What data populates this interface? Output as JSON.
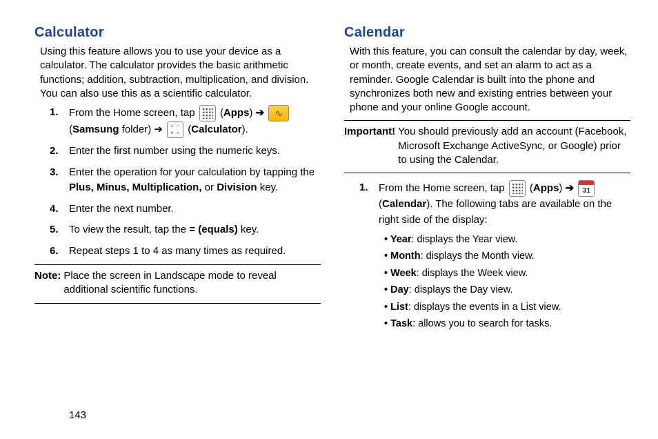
{
  "page_number": "143",
  "left": {
    "heading": "Calculator",
    "intro": "Using this feature allows you to use your device as a calculator. The calculator provides the basic arithmetic functions; addition, subtraction, multiplication, and division. You can also use this as a scientific calculator.",
    "step1_a": "From the Home screen, tap ",
    "step1_apps": "Apps",
    "step1_arrow": " ➔ ",
    "step1_samsung": "Samsung",
    "step1_folder": " folder) ➔ ",
    "step1_calc": "Calculator",
    "step2": "Enter the first number using the numeric keys.",
    "step3_a": "Enter the operation for your calculation by tapping the ",
    "step3_b": "Plus, Minus, Multiplication,",
    "step3_c": " or ",
    "step3_d": "Division",
    "step3_e": " key.",
    "step4": "Enter the next number.",
    "step5_a": "To view the result, tap the ",
    "step5_b": "=  (equals)",
    "step5_c": " key.",
    "step6": "Repeat steps 1 to 4 as many times as required.",
    "note_label": "Note:",
    "note_text": "Place the screen in Landscape mode to reveal additional scientific functions."
  },
  "right": {
    "heading": "Calendar",
    "intro": "With this feature, you can consult the calendar by day, week, or month, create events, and set an alarm to act as a reminder. Google Calendar is built into the phone and synchronizes both new and existing entries between your phone and your online Google account.",
    "imp_label": "Important!",
    "imp_text": "You should previously add an account (Facebook, Microsoft Exchange ActiveSync, or Google) prior to using the Calendar.",
    "step1_a": "From the Home screen, tap ",
    "step1_apps": "Apps",
    "step1_arrow": " ➔ ",
    "step1_cal": "Calendar",
    "step1_b": "). The following tabs are available on the right side of the display:",
    "bullets": {
      "year_b": "Year",
      "year_t": ": displays the Year view.",
      "month_b": "Month",
      "month_t": ": displays the Month view.",
      "week_b": "Week",
      "week_t": ": displays the Week view.",
      "day_b": "Day",
      "day_t": ": displays the Day view.",
      "list_b": "List",
      "list_t": ": displays the events in a List view.",
      "task_b": "Task",
      "task_t": ": allows you to search for tasks."
    }
  }
}
